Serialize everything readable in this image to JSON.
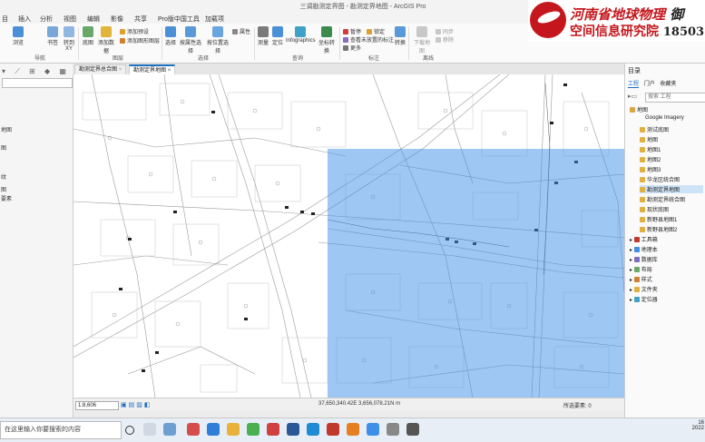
{
  "window": {
    "title": "三调勘测定界图 - 勘测定界地图 - ArcGIS Pro"
  },
  "ribbon_tabs": [
    "目",
    "插入",
    "分析",
    "视图",
    "编辑",
    "影像",
    "共享",
    "Pro版中国工具",
    "加载项"
  ],
  "ribbon": {
    "nav": {
      "explore": "浏览",
      "bookmarks": "书签",
      "goto": "转到\nXY",
      "label": "导航"
    },
    "layer": {
      "basemap": "底图",
      "add_data": "添加数据",
      "add_preset": "添加预设",
      "add_graphics": "添加图形图层",
      "label": "图层"
    },
    "selection": {
      "select": "选择",
      "by_attr": "按属性选择",
      "by_loc": "按位置选择",
      "attr": "属性",
      "label": "选择"
    },
    "inquiry": {
      "measure": "测量",
      "locate": "定位",
      "infographics": "Infographics",
      "coord_convert": "坐标转换",
      "label": "查询"
    },
    "labeling": {
      "pause": "暂停",
      "lock": "锁定",
      "view_unplaced": "查看未放置的标注",
      "more": "更多",
      "convert": "转换",
      "label": "标注"
    },
    "offline": {
      "download": "下载地图",
      "sync": "同步",
      "remove": "移除",
      "label": "离线"
    }
  },
  "logo": {
    "line1": "河南省地球物理",
    "line2": "空间信息研究院",
    "phone": "18503",
    "right_char": "御"
  },
  "left_pane": {
    "items": [
      "地图",
      "图",
      "纹",
      "图",
      "要素"
    ]
  },
  "map_tabs": [
    {
      "label": "勘测定界总合图",
      "active": false
    },
    {
      "label": "勘测定界地图",
      "active": true
    }
  ],
  "status": {
    "scale": "1:8,606",
    "coords": "37,650,340.42E  3,656,078.21N m",
    "selected": "所选要素: 0"
  },
  "catalog": {
    "title": "目录",
    "tabs": [
      "工程",
      "门户",
      "收藏夹"
    ],
    "search_placeholder": "搜索 工程",
    "root": "地图",
    "maps": [
      "Google Imagery",
      "测试底图",
      "地图",
      "地图1",
      "地图2",
      "地图3",
      "华龙区统合图",
      "勘测定界地图",
      "勘测定界统合图",
      "现状底图",
      "新野县地图1",
      "新野县地图2"
    ],
    "selected_map": "勘测定界地图",
    "folders": [
      "工具箱",
      "地理本",
      "数据库",
      "布局",
      "样式",
      "文件夹",
      "定位器"
    ]
  },
  "taskbar": {
    "search_text": "在这里输入你要搜索的内容",
    "time": "16",
    "date": "2022"
  },
  "colors": {
    "accent": "#1f6fbf",
    "selection_overlay": "#3d8fe8",
    "brand_red": "#c4161c"
  }
}
